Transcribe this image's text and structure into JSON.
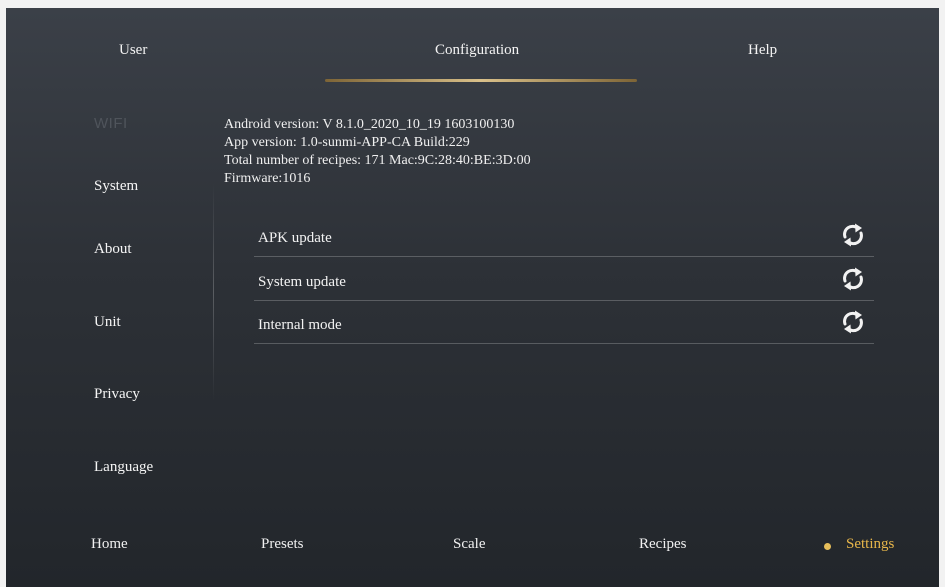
{
  "tabs": [
    {
      "label": "User"
    },
    {
      "label": "Configuration"
    },
    {
      "label": "Help"
    }
  ],
  "sidebar": {
    "items": [
      {
        "label": "WIFI"
      },
      {
        "label": "System"
      },
      {
        "label": "About"
      },
      {
        "label": "Unit"
      },
      {
        "label": "Privacy"
      },
      {
        "label": "Language"
      }
    ]
  },
  "info": {
    "android_version": "Android version: V 8.1.0_2020_10_19 1603100130",
    "app_version": "App version: 1.0-sunmi-APP-CA Build:229",
    "recipes_mac": "Total number of recipes: 171 Mac:9C:28:40:BE:3D:00",
    "firmware": "Firmware:1016"
  },
  "updates": [
    {
      "label": "APK update",
      "icon": "refresh-icon"
    },
    {
      "label": "System update",
      "icon": "refresh-icon"
    },
    {
      "label": "Internal mode",
      "icon": "refresh-icon"
    }
  ],
  "bottom_nav": {
    "items": [
      {
        "label": "Home"
      },
      {
        "label": "Presets"
      },
      {
        "label": "Scale"
      },
      {
        "label": "Recipes"
      },
      {
        "label": "Settings"
      }
    ]
  },
  "colors": {
    "accent": "#e7b64a",
    "tab_underline": "#d9c08a",
    "background_top": "#3b4048",
    "background_bottom": "#22262b"
  }
}
